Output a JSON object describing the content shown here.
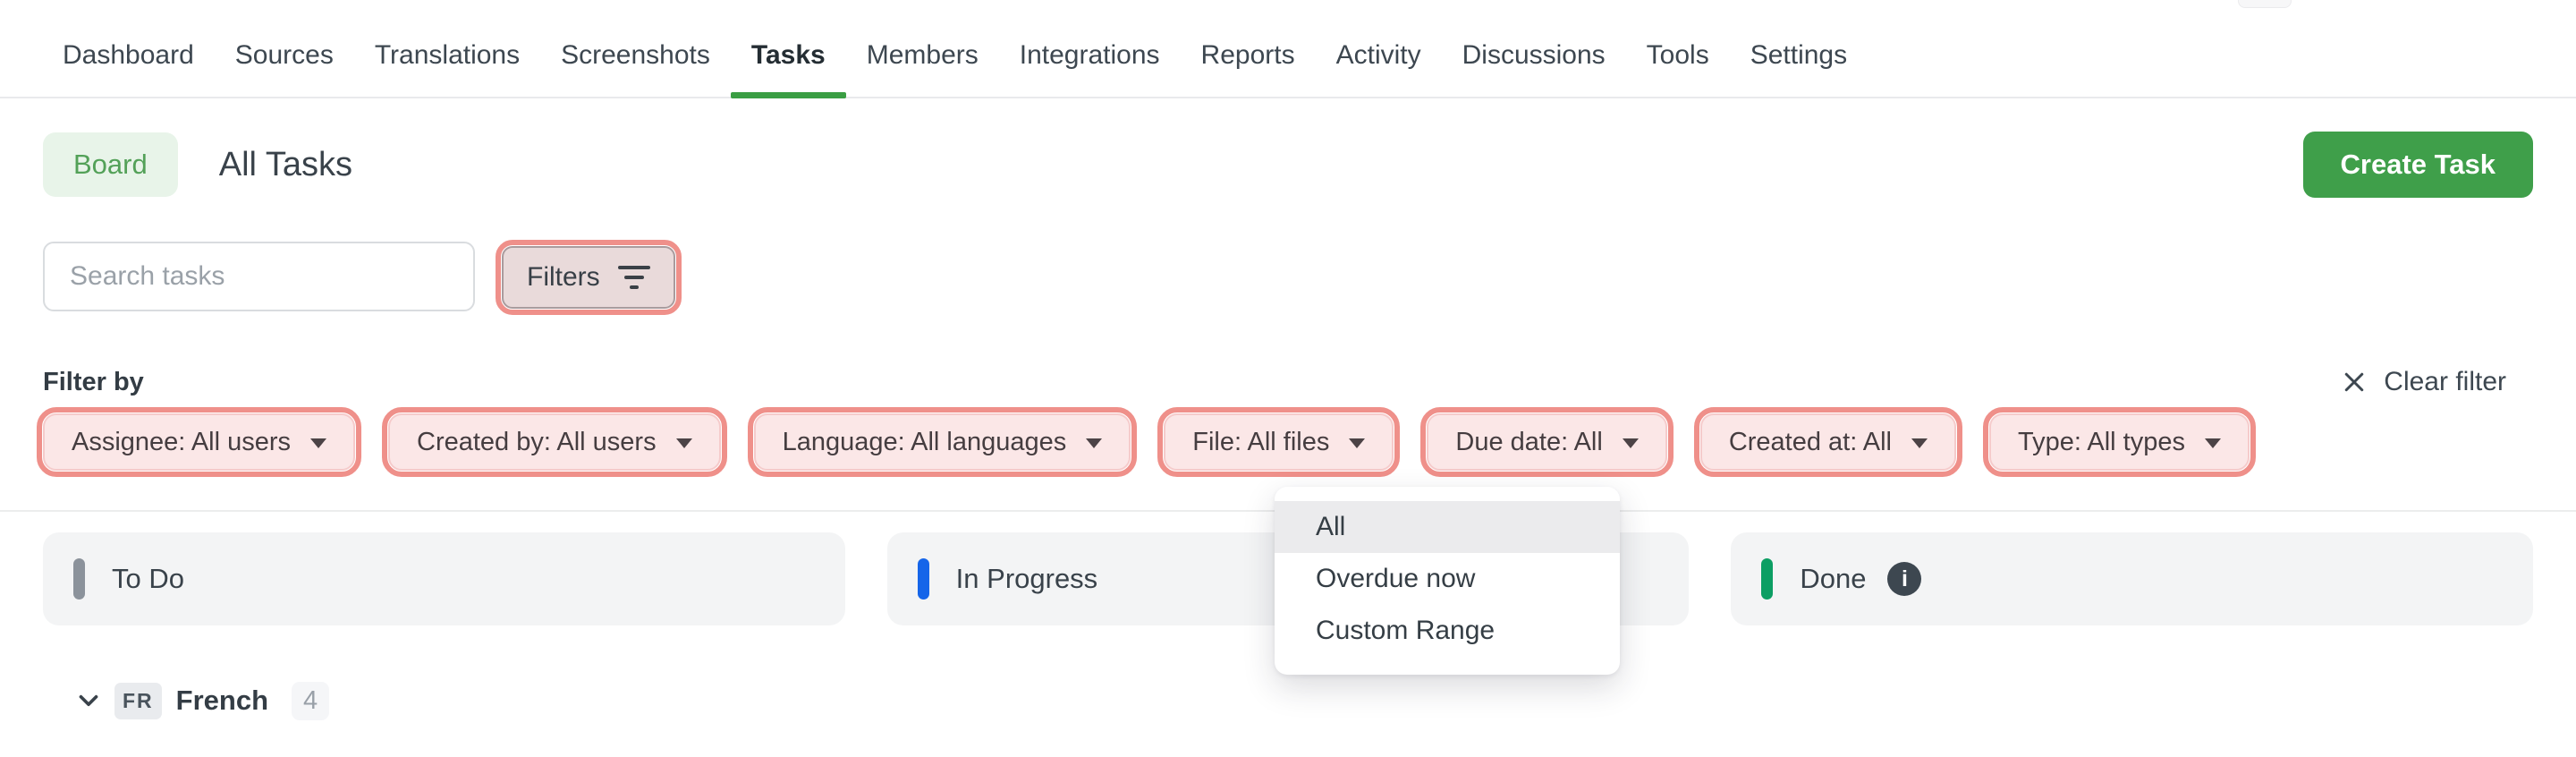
{
  "nav": {
    "items": [
      {
        "label": "Dashboard",
        "active": false
      },
      {
        "label": "Sources",
        "active": false
      },
      {
        "label": "Translations",
        "active": false
      },
      {
        "label": "Screenshots",
        "active": false
      },
      {
        "label": "Tasks",
        "active": true
      },
      {
        "label": "Members",
        "active": false
      },
      {
        "label": "Integrations",
        "active": false
      },
      {
        "label": "Reports",
        "active": false
      },
      {
        "label": "Activity",
        "active": false
      },
      {
        "label": "Discussions",
        "active": false
      },
      {
        "label": "Tools",
        "active": false
      },
      {
        "label": "Settings",
        "active": false
      }
    ]
  },
  "header": {
    "board_label": "Board",
    "title": "All Tasks",
    "create_task_label": "Create Task"
  },
  "search": {
    "placeholder": "Search tasks"
  },
  "filters_button": {
    "label": "Filters",
    "icon": "filter-lines-icon"
  },
  "filter_bar": {
    "label": "Filter by",
    "clear_label": "Clear filter",
    "clear_icon": "close-icon",
    "chips": [
      {
        "label": "Assignee: All users"
      },
      {
        "label": "Created by: All users"
      },
      {
        "label": "Language: All languages"
      },
      {
        "label": "File: All files"
      },
      {
        "label": "Due date: All"
      },
      {
        "label": "Created at: All"
      },
      {
        "label": "Type: All types"
      }
    ]
  },
  "due_date_menu": {
    "items": [
      {
        "label": "All",
        "highlighted": true
      },
      {
        "label": "Overdue now",
        "highlighted": false
      },
      {
        "label": "Custom Range",
        "highlighted": false
      }
    ]
  },
  "board": {
    "columns": [
      {
        "label": "To Do",
        "pill_color": "#8b929b",
        "pill_style": "background:#8b929b",
        "has_info": false
      },
      {
        "label": "In Progress",
        "pill_color": "#1565e9",
        "pill_style": "background:#1565e9",
        "has_info": false
      },
      {
        "label": "Done",
        "pill_color": "#0c9e63",
        "pill_style": "background:#0c9e63",
        "has_info": true,
        "info_icon": "info-icon",
        "info_glyph": "i"
      }
    ]
  },
  "group_row": {
    "lang_code": "FR",
    "lang_name": "French",
    "count": "4"
  },
  "colors": {
    "accent_green": "#3f9f4a",
    "green_underline": "#3a9e43",
    "board_bg": "#e8f4e9",
    "board_text": "#53a158",
    "ring_pink": "#ef908a",
    "chip_bg": "#fbe7e7",
    "chip_border": "#f5cbcb",
    "filters_bg": "#e9dada",
    "filters_border": "#a99b9d",
    "column_bg": "#f3f4f5",
    "menu_highlight": "#ebebed"
  }
}
